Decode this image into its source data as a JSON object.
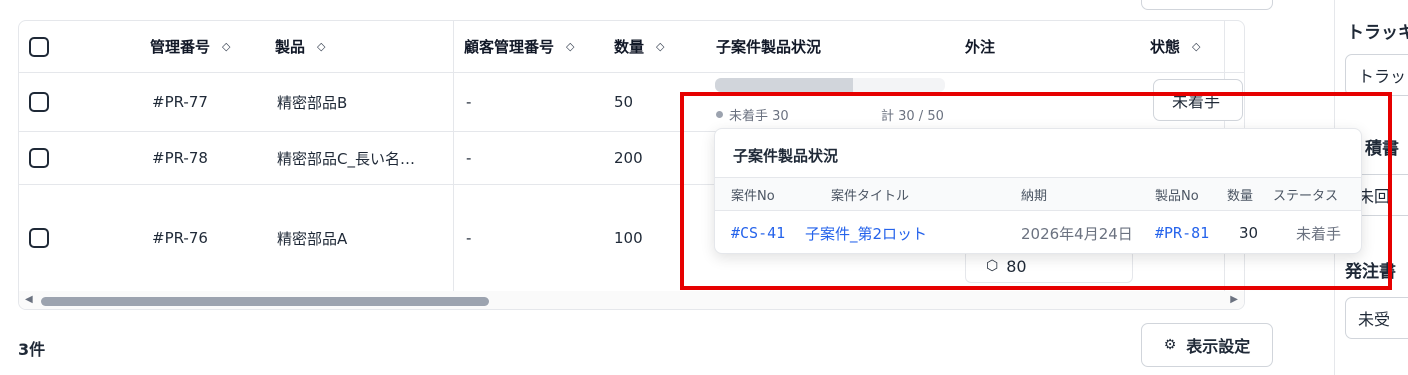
{
  "table": {
    "headers": {
      "mgmt_no": "管理番号",
      "product": "製品",
      "customer_mgmt_no": "顧客管理番号",
      "quantity": "数量",
      "sub_status": "子案件製品状況",
      "outsource": "外注",
      "status": "状態"
    },
    "rows": [
      {
        "mgmt_no": "#PR-77",
        "product": "精密部品B",
        "customer_mgmt_no": "-",
        "quantity": "50"
      },
      {
        "mgmt_no": "#PR-78",
        "product": "精密部品C_長い名…",
        "customer_mgmt_no": "-",
        "quantity": "200"
      },
      {
        "mgmt_no": "#PR-76",
        "product": "精密部品A",
        "customer_mgmt_no": "-",
        "quantity": "100"
      }
    ],
    "row1_progress": {
      "label": "未着手 30",
      "total": "計 30 / 50",
      "fraction": 0.6
    },
    "row1_status_btn": "未着手",
    "row3_outsource_value": "80",
    "more_label": "…"
  },
  "footer": {
    "count": "3件",
    "display_settings": "表示設定"
  },
  "right_panel": {
    "tracking_title": "トラッキ",
    "tracking_value": "トラッ",
    "estimate_title": "積書",
    "estimate_value": "未回",
    "order_title": "発注書",
    "order_value": "未受"
  },
  "popover": {
    "title": "子案件製品状況",
    "columns": [
      "案件No",
      "案件タイトル",
      "納期",
      "製品No",
      "数量",
      "ステータス"
    ],
    "rows": [
      {
        "case_no": "#CS-41",
        "case_title": "子案件_第2ロット",
        "due": "2026年4月24日",
        "product_no": "#PR-81",
        "qty": "30",
        "status": "未着手"
      }
    ]
  },
  "colors": {
    "link": "#2563eb",
    "highlight": "#e60000"
  },
  "icons": {
    "sort": "sort-icon",
    "package": "package-icon",
    "settings": "sliders-icon"
  }
}
